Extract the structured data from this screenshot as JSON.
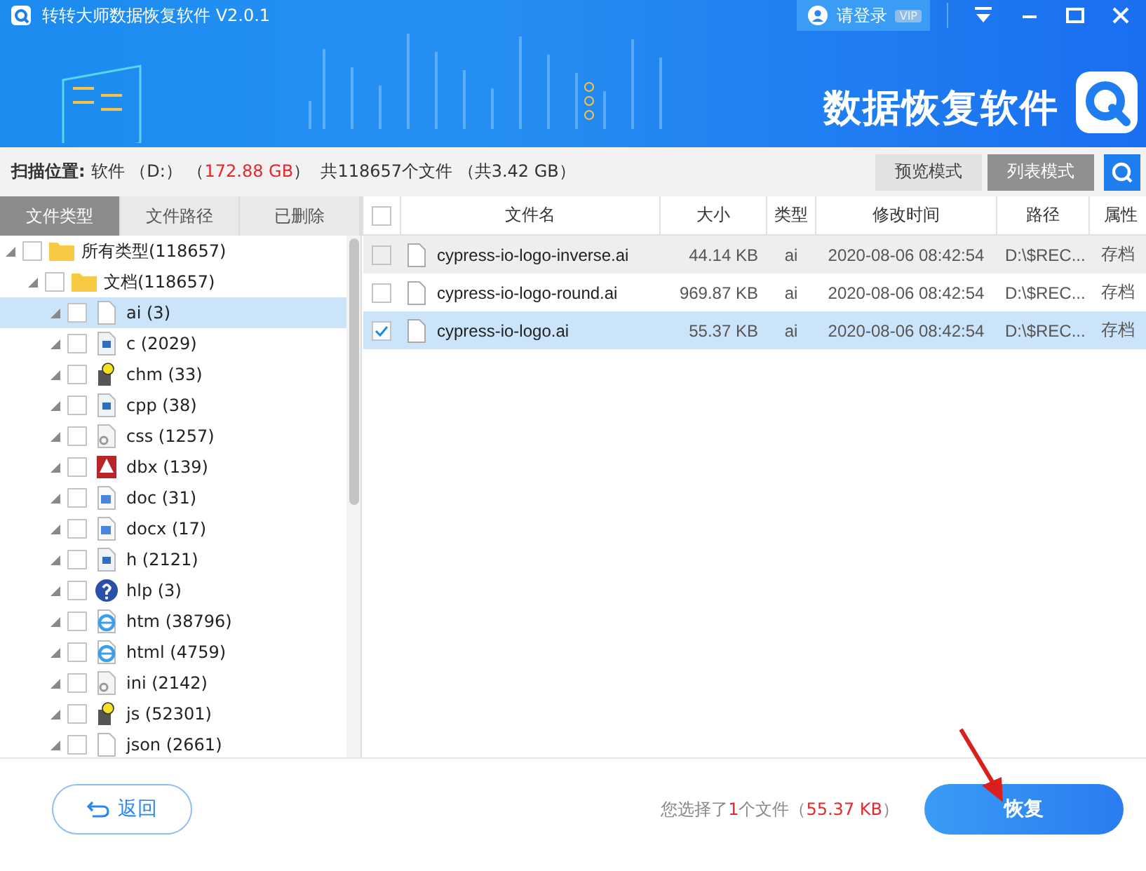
{
  "window": {
    "title": "转转大师数据恢复软件 V2.0.1",
    "login": "请登录",
    "vip": "VIP"
  },
  "banner": {
    "title": "数据恢复软件"
  },
  "scan_bar": {
    "label": "扫描位置:",
    "parts": [
      {
        "text": "软件 （D:） （",
        "highlight": false
      },
      {
        "text": "172.88 GB",
        "highlight": true
      },
      {
        "text": "）  共118657个文件 （共3.42 GB）",
        "highlight": false
      }
    ],
    "modes": [
      {
        "label": "预览模式",
        "selected": false
      },
      {
        "label": "列表模式",
        "selected": true
      }
    ]
  },
  "sidebar": {
    "tabs": [
      {
        "label": "文件类型",
        "selected": true
      },
      {
        "label": "文件路径",
        "selected": false
      },
      {
        "label": "已删除",
        "selected": false
      }
    ],
    "tree": [
      {
        "label": "所有类型(118657)",
        "checked": false,
        "selected": false,
        "kind": "folder",
        "children": [
          {
            "label": "文档(118657)",
            "checked": false,
            "selected": false,
            "kind": "folder",
            "children": [
              {
                "label": "ai (3)",
                "checked": false,
                "selected": true,
                "kind": "file"
              },
              {
                "label": "c (2029)",
                "checked": false,
                "selected": false,
                "kind": "code"
              },
              {
                "label": "chm (33)",
                "checked": false,
                "selected": false,
                "kind": "chm"
              },
              {
                "label": "cpp (38)",
                "checked": false,
                "selected": false,
                "kind": "code"
              },
              {
                "label": "css (1257)",
                "checked": false,
                "selected": false,
                "kind": "gear"
              },
              {
                "label": "dbx (139)",
                "checked": false,
                "selected": false,
                "kind": "red"
              },
              {
                "label": "doc (31)",
                "checked": false,
                "selected": false,
                "kind": "word"
              },
              {
                "label": "docx (17)",
                "checked": false,
                "selected": false,
                "kind": "word"
              },
              {
                "label": "h (2121)",
                "checked": false,
                "selected": false,
                "kind": "code"
              },
              {
                "label": "hlp (3)",
                "checked": false,
                "selected": false,
                "kind": "help"
              },
              {
                "label": "htm (38796)",
                "checked": false,
                "selected": false,
                "kind": "web"
              },
              {
                "label": "html (4759)",
                "checked": false,
                "selected": false,
                "kind": "web"
              },
              {
                "label": "ini (2142)",
                "checked": false,
                "selected": false,
                "kind": "gear"
              },
              {
                "label": "js (52301)",
                "checked": false,
                "selected": false,
                "kind": "chm"
              },
              {
                "label": "json (2661)",
                "checked": false,
                "selected": false,
                "kind": "file"
              }
            ]
          }
        ]
      }
    ]
  },
  "table": {
    "all_checked": false,
    "columns": [
      "文件名",
      "大小",
      "类型",
      "修改时间",
      "路径",
      "属性"
    ],
    "rows": [
      {
        "name": "cypress-io-logo-inverse.ai",
        "size": "44.14 KB",
        "type": "ai",
        "modified": "2020-08-06 08:42:54",
        "path": "D:\\$REC...",
        "attribute": "存档",
        "checked": false,
        "selected": false,
        "hovered": true
      },
      {
        "name": "cypress-io-logo-round.ai",
        "size": "969.87 KB",
        "type": "ai",
        "modified": "2020-08-06 08:42:54",
        "path": "D:\\$REC...",
        "attribute": "存档",
        "checked": false,
        "selected": false,
        "hovered": false
      },
      {
        "name": "cypress-io-logo.ai",
        "size": "55.37 KB",
        "type": "ai",
        "modified": "2020-08-06 08:42:54",
        "path": "D:\\$REC...",
        "attribute": "存档",
        "checked": true,
        "selected": true,
        "hovered": false
      }
    ]
  },
  "footer": {
    "back": "返回",
    "summary": [
      {
        "text": "您选择了",
        "highlight": false
      },
      {
        "text": "1",
        "highlight": true
      },
      {
        "text": "个文件（",
        "highlight": false
      },
      {
        "text": "55.37 KB",
        "highlight": true
      },
      {
        "text": "）",
        "highlight": false
      }
    ],
    "recover": "恢复"
  }
}
